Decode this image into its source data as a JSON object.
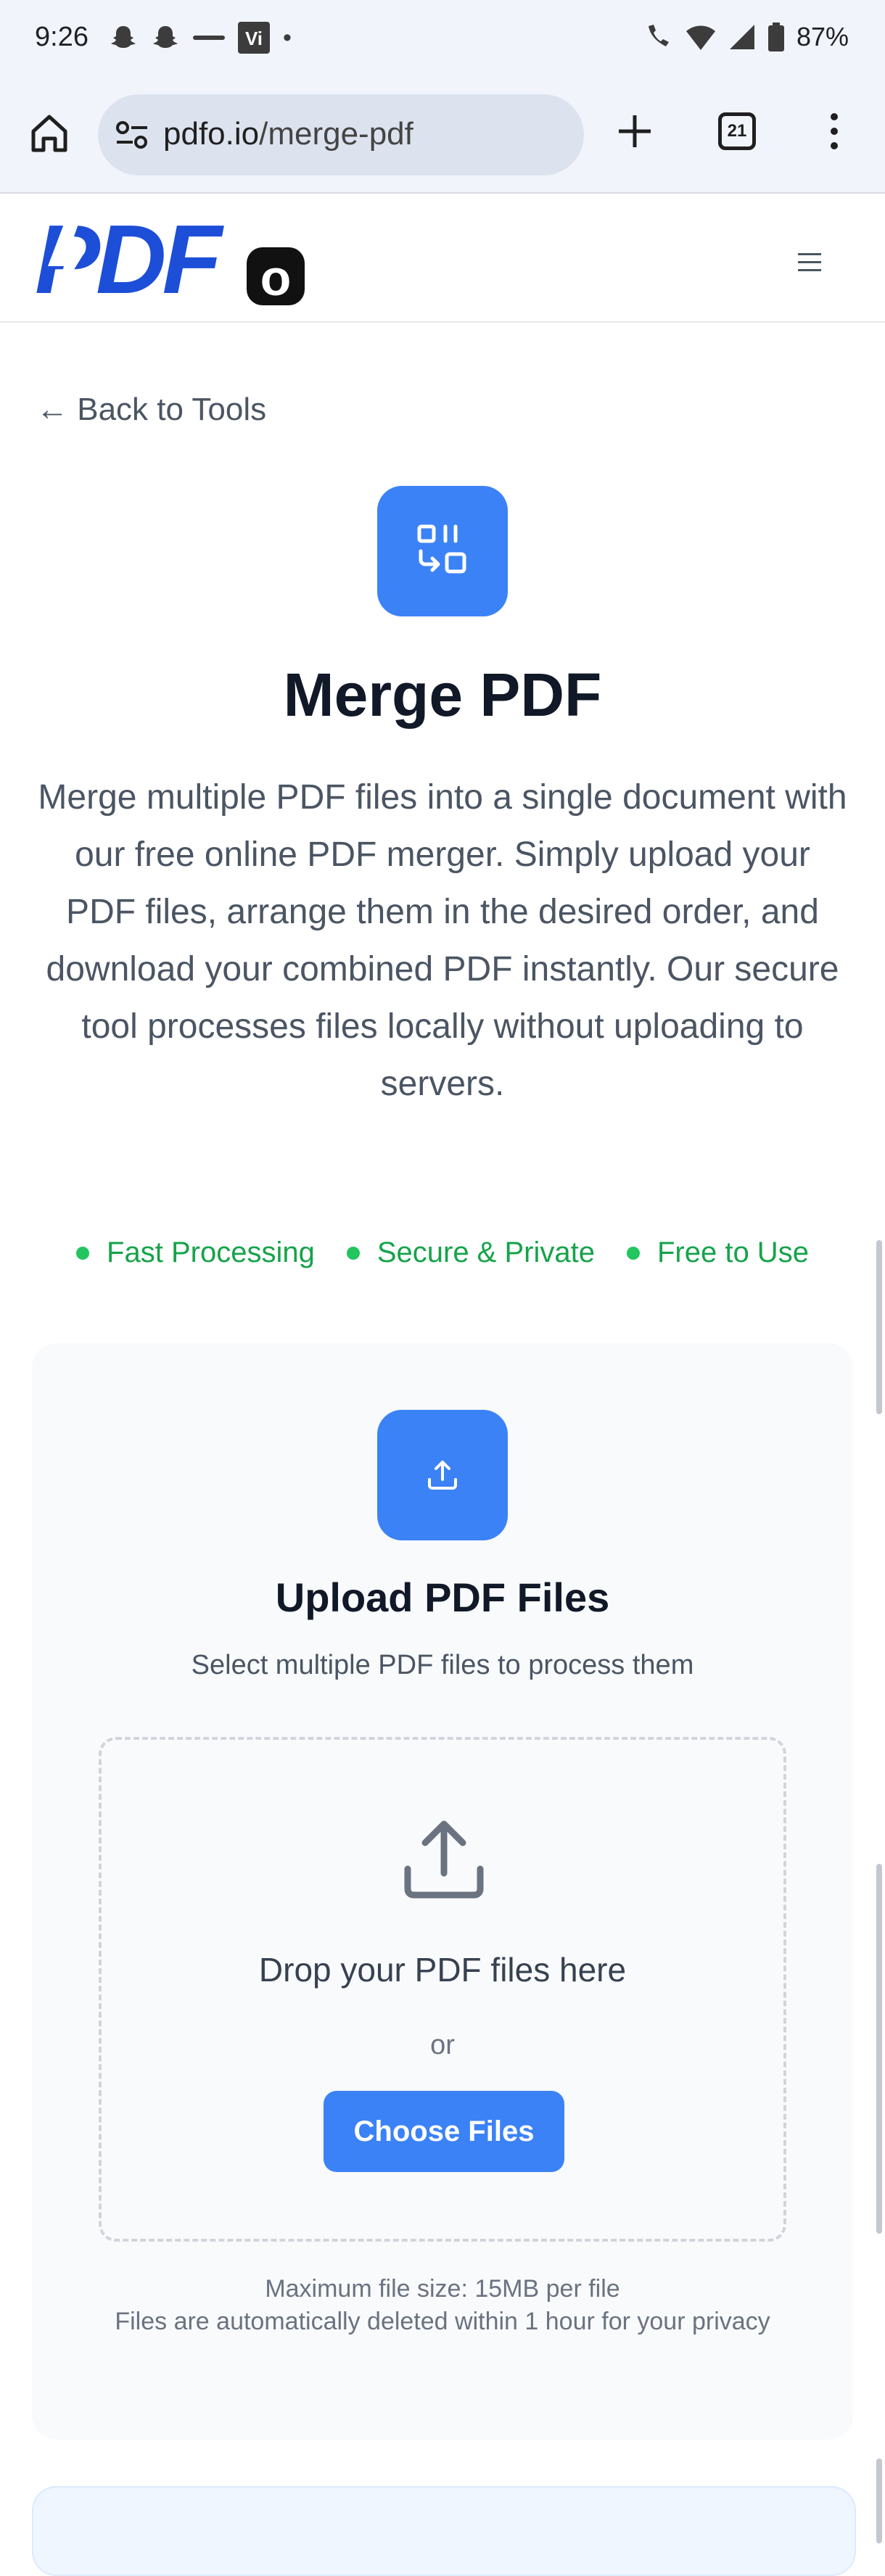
{
  "status_bar": {
    "time": "9:26",
    "dot": "•",
    "battery": "87%",
    "icons": [
      "snapchat-icon",
      "snapchat-icon",
      "app-icon",
      "vi-icon",
      "wifi-call-icon",
      "wifi-icon",
      "signal-icon",
      "battery-icon"
    ]
  },
  "browser": {
    "url_domain": "pdfo.io",
    "url_path": "/merge-pdf",
    "tab_count": "21"
  },
  "site": {
    "logo_text": "PDFo"
  },
  "page": {
    "back_link": "← Back to Tools",
    "title": "Merge PDF",
    "description": "Merge multiple PDF files into a single document with our free online PDF merger. Simply upload your PDF files, arrange them in the desired order, and download your combined PDF instantly. Our secure tool processes files locally without uploading to servers.",
    "features": [
      "Fast Processing",
      "Secure & Private",
      "Free to Use"
    ]
  },
  "upload": {
    "title": "Upload PDF Files",
    "subtitle": "Select multiple PDF files to process them",
    "drop_text": "Drop your PDF files here",
    "or_text": "or",
    "button_label": "Choose Files",
    "note_size": "Maximum file size: 15MB per file",
    "note_privacy": "Files are automatically deleted within 1 hour for your privacy"
  },
  "colors": {
    "accent": "#3b82f6",
    "feature_green": "#16a34a",
    "logo_blue": "#1d4ed8"
  }
}
